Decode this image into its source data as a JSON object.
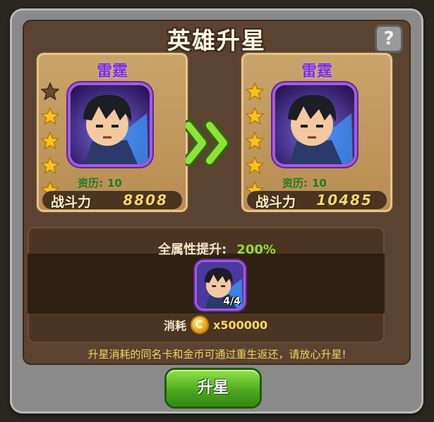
{
  "dialog": {
    "title": "英雄升星",
    "help_label": "?"
  },
  "current": {
    "name": "雷霆",
    "stars_filled": 4,
    "stars_total": 5,
    "qualification_label": "资历:",
    "qualification_value": "10",
    "power_label": "战斗力",
    "power_value": "8808"
  },
  "next": {
    "name": "雷霆",
    "stars_filled": 5,
    "stars_total": 5,
    "qualification_label": "资历:",
    "qualification_value": "10",
    "power_label": "战斗力",
    "power_value": "10485"
  },
  "bonus": {
    "label": "全属性提升:",
    "value": "200%"
  },
  "material": {
    "count": "4/4"
  },
  "cost": {
    "label": "消耗",
    "amount": "x500000"
  },
  "note": "升星消耗的同名卡和金币可通过重生返还，请放心升星!",
  "action": {
    "button_label": "升星"
  },
  "colors": {
    "star_gold": "#f7c31a",
    "star_empty": "#6a4a30",
    "name_purple": "#7a2fd0",
    "button_green": "#4aa51c"
  }
}
